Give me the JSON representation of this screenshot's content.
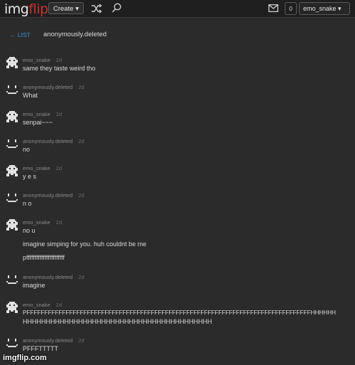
{
  "nav": {
    "logo_main": "img",
    "logo_accent": "flip",
    "create_label": "Create",
    "notif_count": "0",
    "username": "emo_snake"
  },
  "conversation": {
    "back_label": "← LIST",
    "title": "anonymously.deleted"
  },
  "messages": [
    {
      "user": "emo_snake",
      "time": "2d",
      "lines": [
        "same they taste weird tho"
      ]
    },
    {
      "user": "anonymously.deleted",
      "time": "2d",
      "lines": [
        "What"
      ]
    },
    {
      "user": "emo_snake",
      "time": "2d",
      "lines": [
        "senpai~~~"
      ]
    },
    {
      "user": "anonymously.deleted",
      "time": "2d",
      "lines": [
        "no"
      ]
    },
    {
      "user": "emo_snake",
      "time": "2d",
      "lines": [
        "y e s"
      ]
    },
    {
      "user": "anonymously.deleted",
      "time": "2d",
      "lines": [
        "n o"
      ]
    },
    {
      "user": "emo_snake",
      "time": "2d",
      "lines": [
        "no u",
        "imagine simping for you. huh couldnt be me",
        "pfffffffffffffffffffffff"
      ]
    },
    {
      "user": "anonymously.deleted",
      "time": "2d",
      "lines": [
        "imagine"
      ]
    },
    {
      "user": "emo_snake",
      "time": "2d",
      "lines": [
        "PFFFFFFFFFFFFFFFFFFFFFFFFFFFFFFFFFFFFFFFFFFFFFFFFFFFFFFFFFFFFFFFFFFFFFFFFFFFFFFFFHHHHHH",
        "HHHHHHHHHHHHHHHHHHHHHHHHHHHHHHHHHHHHHHHHH"
      ]
    },
    {
      "user": "anonymously.deleted",
      "time": "2d",
      "lines": [
        "PFFFTTTTT"
      ]
    }
  ],
  "watermark": "imgflip.com",
  "icons": {
    "emo_avatar": "pixel-alien-icon",
    "anon_avatar": "smiley-face-icon"
  }
}
